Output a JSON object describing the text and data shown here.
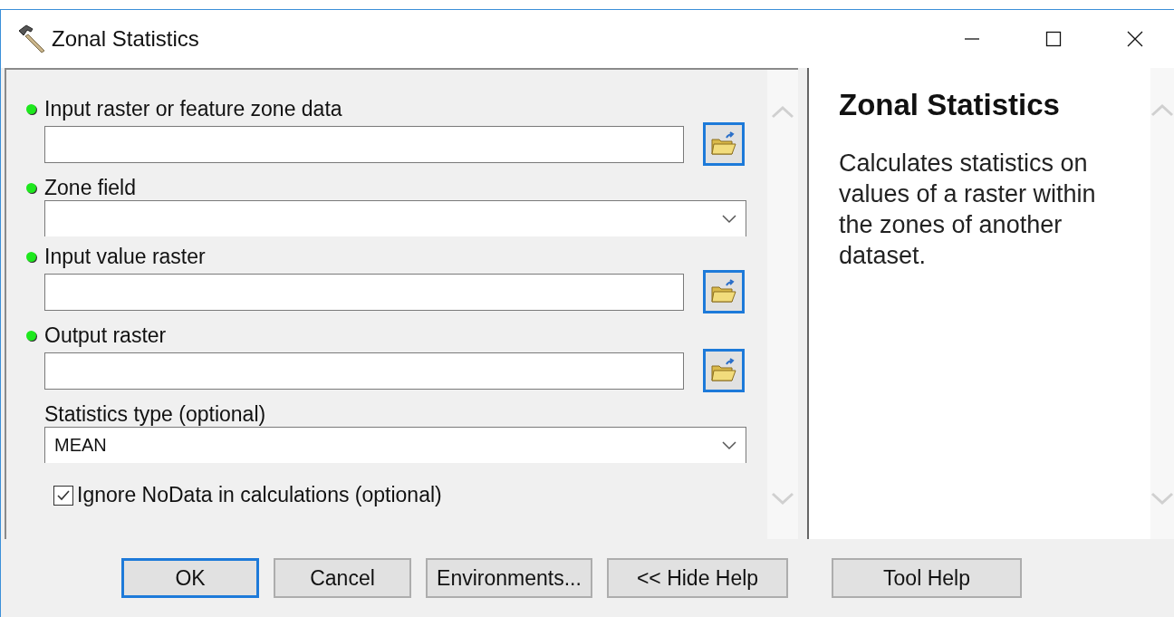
{
  "window": {
    "title": "Zonal Statistics"
  },
  "parameters": [
    {
      "kind": "path",
      "label": "Input raster or feature zone data",
      "required": true
    },
    {
      "kind": "dropdown",
      "label": "Zone field",
      "required": true
    },
    {
      "kind": "path",
      "label": "Input value raster",
      "required": true
    },
    {
      "kind": "path",
      "label": "Output raster",
      "required": true
    },
    {
      "kind": "dropdown",
      "label": "Statistics type (optional)",
      "required": false,
      "value": "MEAN"
    },
    {
      "kind": "checkbox",
      "label": "Ignore NoData in calculations (optional)",
      "checked": true
    }
  ],
  "help": {
    "title": "Zonal Statistics",
    "text": "Calculates statistics on values of a raster within the zones of another dataset."
  },
  "buttons": [
    {
      "label": "OK",
      "default": true
    },
    {
      "label": "Cancel",
      "default": false
    },
    {
      "label": "Environments...",
      "default": false
    },
    {
      "label": "<< Hide Help",
      "default": false
    },
    {
      "label": "Tool Help",
      "default": false
    }
  ]
}
